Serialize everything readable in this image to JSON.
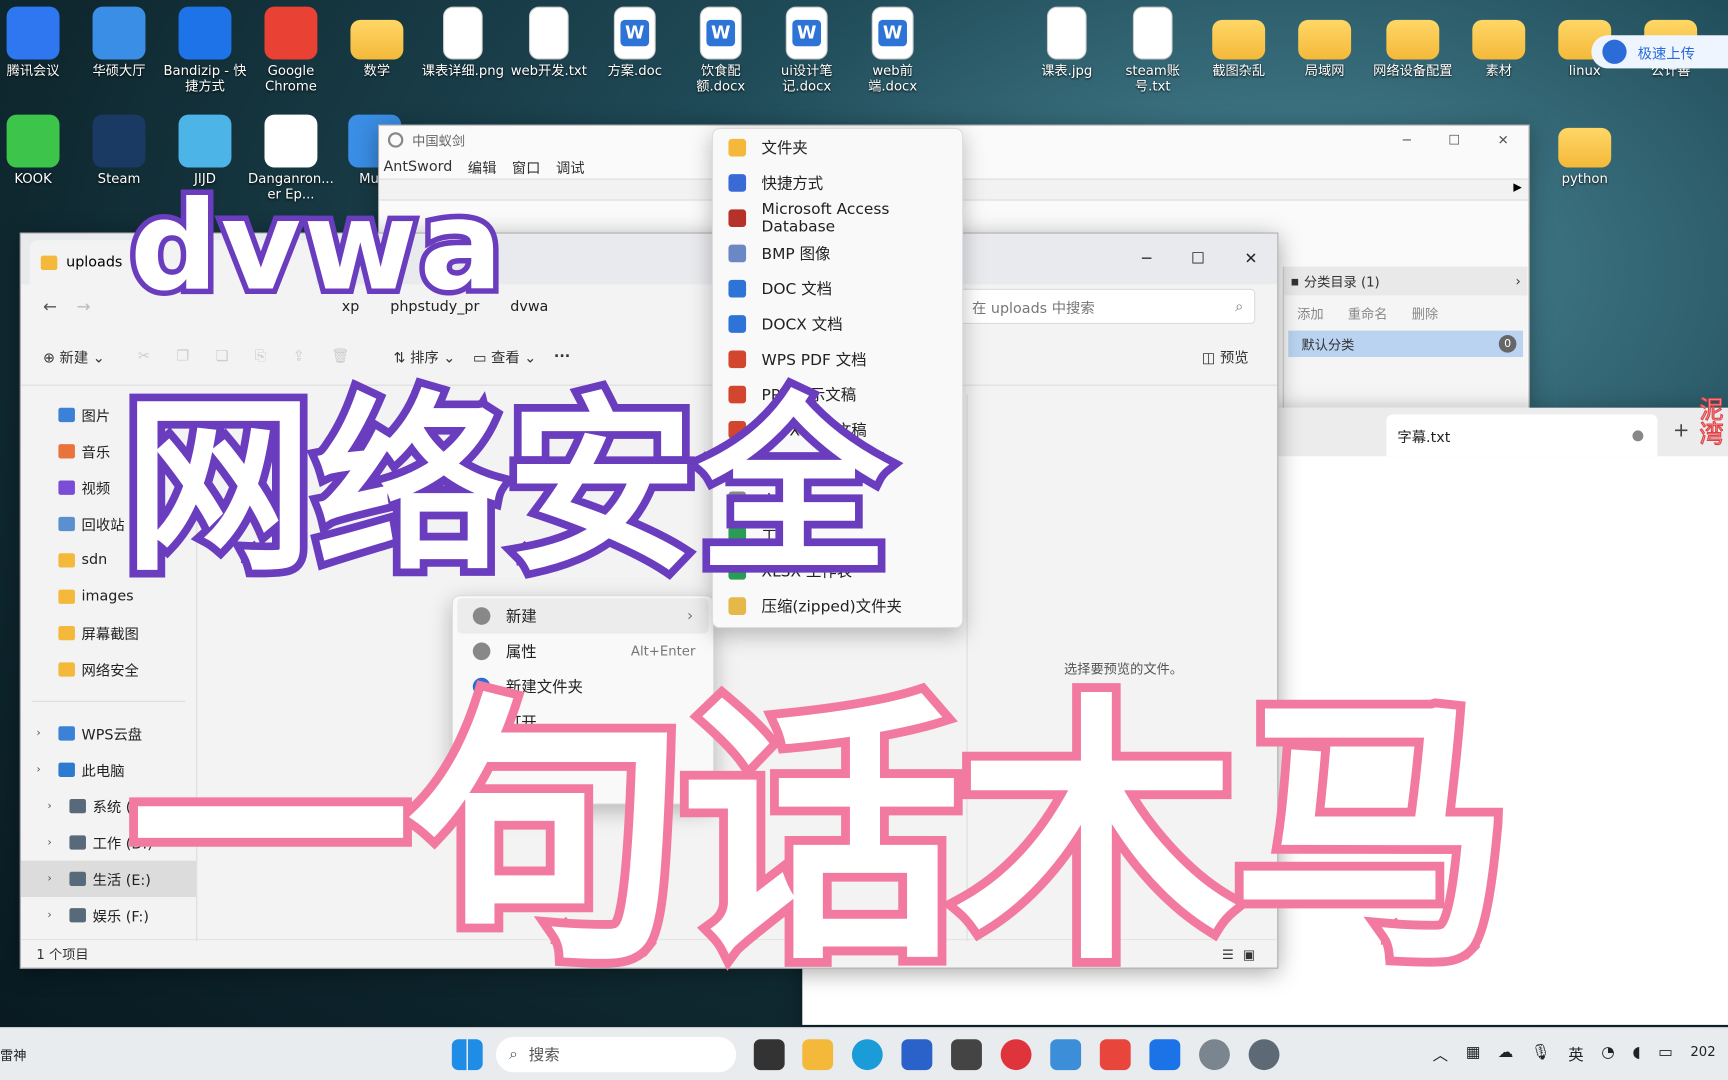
{
  "desktop_icons": [
    {
      "label": "腾讯会议",
      "icon": "meeting-icon",
      "color": "#2f77f1"
    },
    {
      "label": "华硕大厅",
      "icon": "asus-icon",
      "color": "#3a8ee6"
    },
    {
      "label": "Bandizip - 快捷方式",
      "icon": "bandizip-icon",
      "color": "#1e73e8"
    },
    {
      "label": "Google Chrome",
      "icon": "chrome-icon",
      "color": "#e94235"
    },
    {
      "label": "数学",
      "icon": "folder-icon",
      "color": "#f4b93a"
    },
    {
      "label": "课表详细.png",
      "icon": "image-file-icon",
      "color": "#ffffff"
    },
    {
      "label": "web开发.txt",
      "icon": "text-file-icon",
      "color": "#ffffff"
    },
    {
      "label": "方案.doc",
      "icon": "word-icon",
      "color": "#2e74d6"
    },
    {
      "label": "饮食配额.docx",
      "icon": "word-icon",
      "color": "#2e74d6"
    },
    {
      "label": "ui设计笔记.docx",
      "icon": "word-icon",
      "color": "#2e74d6"
    },
    {
      "label": "web前端.docx",
      "icon": "word-icon",
      "color": "#2e74d6"
    },
    {
      "label": "课表.jpg",
      "icon": "image-file-icon",
      "color": "#ffffff"
    },
    {
      "label": "steam账号.txt",
      "icon": "text-file-icon",
      "color": "#ffffff"
    },
    {
      "label": "截图杂乱",
      "icon": "folder-icon",
      "color": "#f4b93a"
    },
    {
      "label": "局域网",
      "icon": "folder-icon",
      "color": "#f4b93a"
    },
    {
      "label": "网络设备配置",
      "icon": "folder-icon",
      "color": "#f4b93a"
    },
    {
      "label": "素材",
      "icon": "folder-icon",
      "color": "#f4b93a"
    },
    {
      "label": "linux",
      "icon": "folder-icon",
      "color": "#f4b93a"
    },
    {
      "label": "公计善",
      "icon": "folder-icon",
      "color": "#f4b93a"
    }
  ],
  "desktop_icons_row2": [
    {
      "label": "KOOK",
      "icon": "kook-icon",
      "color": "#3cc54a"
    },
    {
      "label": "Steam",
      "icon": "steam-icon",
      "color": "#1b3a63"
    },
    {
      "label": "JIJD",
      "icon": "app-icon",
      "color": "#4db4e8"
    },
    {
      "label": "Danganron... er Ep...",
      "icon": "bear-icon",
      "color": "#ffffff"
    },
    {
      "label": "MuM",
      "icon": "app-icon",
      "color": "#3a8ee6"
    },
    {
      "label": "python",
      "icon": "folder-icon",
      "color": "#f4b93a"
    }
  ],
  "cloud_upload": "极速上传",
  "antsword": {
    "title": "中国蚁剑",
    "menu": [
      "AntSword",
      "编辑",
      "窗口",
      "调试"
    ],
    "category_header": "分类目录 (1)",
    "actions": [
      "添加",
      "重命名",
      "删除"
    ],
    "default_category": "默认分类",
    "count": "0"
  },
  "explorer": {
    "tab_title": "uploads",
    "breadcrumb": [
      "xp",
      "phpstudy_pr",
      "dvwa"
    ],
    "search_placeholder": "在 uploads 中搜索",
    "toolbar": {
      "new": "新建",
      "sort": "排序",
      "view": "查看",
      "more": "···",
      "preview": "预览"
    },
    "sidebar": [
      "图片",
      "音乐",
      "视频",
      "回收站",
      "sdn",
      "images",
      "屏幕截图",
      "网络安全"
    ],
    "tree": [
      "WPS云盘",
      "此电脑",
      "系统 (C:)",
      "工作 (D:)",
      "生活 (E:)",
      "娱乐 (F:)"
    ],
    "status": "1 个项目",
    "preview_hint": "选择要预览的文件。"
  },
  "context_menu": [
    {
      "label": "新建",
      "shortcut": ""
    },
    {
      "label": "属性",
      "shortcut": "Alt+Enter"
    },
    {
      "label": "新建文件夹",
      "shortcut": ""
    },
    {
      "label": "打开",
      "shortcut": ""
    }
  ],
  "new_submenu": [
    {
      "label": "文件夹",
      "color": "#f4b93a"
    },
    {
      "label": "快捷方式",
      "color": "#3a6ad6"
    },
    {
      "label": "Microsoft Access Database",
      "color": "#b7312b"
    },
    {
      "label": "BMP 图像",
      "color": "#6a88c4"
    },
    {
      "label": "DOC 文档",
      "color": "#2e74d6"
    },
    {
      "label": "DOCX 文档",
      "color": "#2e74d6"
    },
    {
      "label": "WPS PDF 文档",
      "color": "#d2452e"
    },
    {
      "label": "PPT 演示文稿",
      "color": "#d2452e"
    },
    {
      "label": "PPTX 演示文稿",
      "color": "#d2452e"
    },
    {
      "label": "文件",
      "color": "#888888"
    },
    {
      "label": "文档",
      "color": "#888888"
    },
    {
      "label": "工作表",
      "color": "#2a9d55"
    },
    {
      "label": "XLSX 工作表",
      "color": "#2a9d55"
    },
    {
      "label": "压缩(zipped)文件夹",
      "color": "#e6b84a"
    }
  ],
  "editor": {
    "tab": "字幕.txt",
    "plus": "+"
  },
  "overlay": {
    "line1": "dvwa",
    "line2": "网络安全",
    "line3": "一句话木马",
    "line1_color": "#6a3dbf",
    "line3_color": "#f27aa0"
  },
  "side_text": "泥湾",
  "taskbar": {
    "search_placeholder": "搜索",
    "ime": "英",
    "clock": "202"
  },
  "left_edge_label": "雷神"
}
